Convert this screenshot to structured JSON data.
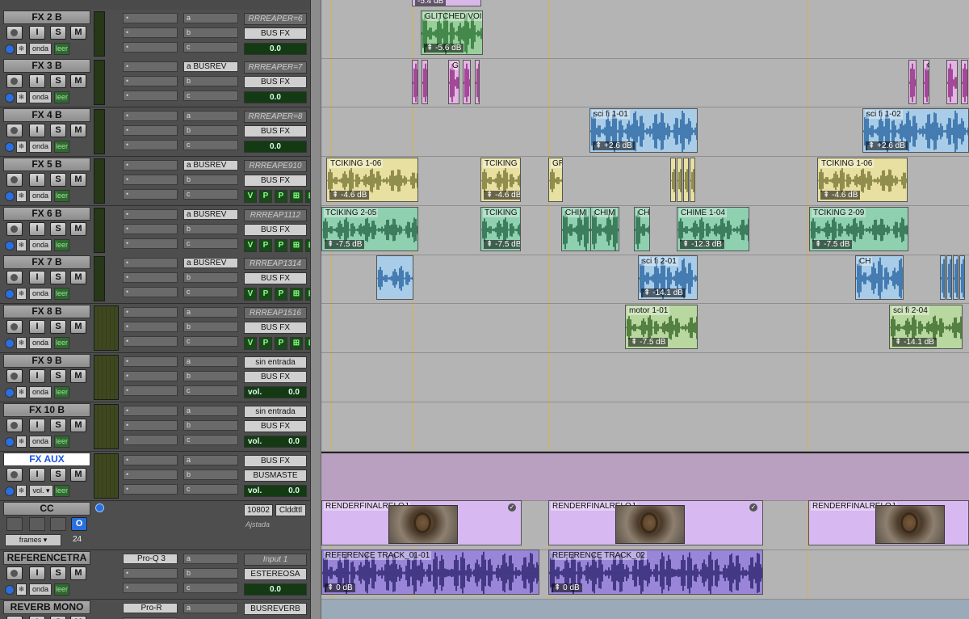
{
  "buttons": {
    "input": "I",
    "solo": "S",
    "mute": "M"
  },
  "tracks": [
    {
      "name": "FX 2 B",
      "ins": "",
      "sends": [
        "a",
        "b",
        "c"
      ],
      "io1": "RRREAPER=6",
      "io2": "BUS FX",
      "vol": "0.0",
      "mode": "onda",
      "leer": "leer",
      "dd": "▲",
      "sendbus": ""
    },
    {
      "name": "FX 3 B",
      "ins": "",
      "sends": [
        "a",
        "b",
        "c"
      ],
      "io1": "RRREAPER=7",
      "io2": "BUS FX",
      "vol": "0.0",
      "mode": "onda",
      "leer": "leer",
      "dd": "▲",
      "sendbus": "BUSREV"
    },
    {
      "name": "FX 4 B",
      "ins": "",
      "sends": [
        "a",
        "b",
        "c"
      ],
      "io1": "RRREAPER=8",
      "io2": "BUS FX",
      "vol": "0.0",
      "mode": "onda",
      "leer": "leer",
      "dd": "▲",
      "sendbus": ""
    },
    {
      "name": "FX 5 B",
      "ins": "",
      "sends": [
        "a",
        "b",
        "c"
      ],
      "io1": "RRREAPE910",
      "io2": "BUS FX",
      "vol": "",
      "mode": "onda",
      "leer": "leer",
      "dd": "▲",
      "sendbus": "BUSREV"
    },
    {
      "name": "FX 6 B",
      "ins": "",
      "sends": [
        "a",
        "b",
        "c"
      ],
      "io1": "RRREAP1112",
      "io2": "BUS FX",
      "vol": "",
      "mode": "onda",
      "leer": "leer",
      "dd": "▲",
      "sendbus": "BUSREV"
    },
    {
      "name": "FX 7 B",
      "ins": "",
      "sends": [
        "a",
        "b",
        "c"
      ],
      "io1": "RRREAP1314",
      "io2": "BUS FX",
      "vol": "",
      "mode": "onda",
      "leer": "leer",
      "dd": "▲",
      "sendbus": "BUSREV"
    },
    {
      "name": "FX 8 B",
      "ins": "",
      "sends": [
        "a",
        "b",
        "c"
      ],
      "io1": "RRREAP1516",
      "io2": "BUS FX",
      "vol": "",
      "mode": "onda",
      "leer": "leer",
      "dd": "▲",
      "sendbus": ""
    },
    {
      "name": "FX 9 B",
      "ins": "",
      "sends": [
        "a",
        "b",
        "c"
      ],
      "io1": "sin entrada",
      "io2": "BUS FX",
      "vol": "0.0",
      "vollabel": "vol.",
      "mode": "onda",
      "leer": "leer",
      "dd": "▲",
      "sendbus": ""
    },
    {
      "name": "FX 10 B",
      "ins": "",
      "sends": [
        "a",
        "b",
        "c"
      ],
      "io1": "sin entrada",
      "io2": "BUS FX",
      "vol": "0.0",
      "vollabel": "vol.",
      "mode": "onda",
      "leer": "leer",
      "dd": "▲",
      "sendbus": ""
    },
    {
      "name": "FX AUX",
      "ins": "",
      "sends": [
        "a",
        "b",
        "c"
      ],
      "io1": "BUS FX",
      "io2": "BUSMASTE",
      "vol": "0.0",
      "vollabel": "vol.",
      "mode": "vol.",
      "leer": "leer",
      "dd": "▼",
      "sendbus": ""
    },
    {
      "name": "CC",
      "tc1": "10802",
      "tc2": "Clddttl",
      "tc3": "Ajstada",
      "frames": "frames",
      "fps": "24"
    },
    {
      "name": "REFERENCETRA",
      "ins": "Pro-Q 3",
      "sends": [
        "a",
        "b",
        "c"
      ],
      "io1": "Input 1",
      "io2": "ESTEREOSA",
      "vol": "0.0",
      "mode": "onda",
      "leer": "leer",
      "dd": "▲",
      "sendbus": ""
    },
    {
      "name": "REVERB MONO",
      "ins": "Pro-R",
      "sends": [
        "a"
      ],
      "io1": "BUSREVERB",
      "io2": "",
      "vol": "",
      "mode": "",
      "leer": "",
      "dd": "",
      "sendbus": ""
    }
  ],
  "vpp": {
    "v": "V",
    "p": "P"
  },
  "clips": {
    "fx2": {
      "label": "GLITCHED VOI",
      "db": "-5.6 dB",
      "color": "#4f9a55"
    },
    "fx3": {
      "labels": [
        "Gl",
        "Gl"
      ],
      "color": "#d9a6d9"
    },
    "fx4": [
      {
        "label": "sci fi 1-01",
        "db": "+2.6 dB"
      },
      {
        "label": "sci fi 1-02",
        "db": "+2.6 dB"
      }
    ],
    "fx5": [
      {
        "label": "TCIKING 1-06",
        "db": "-4.6 dB"
      },
      {
        "label": "TCIKING",
        "db": "-4.6 dB"
      },
      {
        "label": "GR",
        "db": ""
      },
      {
        "label": "TCIKING 1-06",
        "db": "-4.6 dB"
      }
    ],
    "fx6": [
      {
        "label": "TCIKING 2-05",
        "db": "-7.5 dB"
      },
      {
        "label": "TCIKING",
        "db": "-7.5 dB"
      },
      {
        "label": "CHIM",
        "db": ""
      },
      {
        "label": "CHIM",
        "db": ""
      },
      {
        "label": "CH",
        "db": ""
      },
      {
        "label": "CHIME 1-04",
        "db": "-12.3 dB"
      },
      {
        "label": "TCIKING 2-09",
        "db": "-7.5 dB"
      }
    ],
    "fx7": [
      {
        "label": "sci fi 2-01",
        "db": "-14.1 dB"
      },
      {
        "label": "CH",
        "db": ""
      }
    ],
    "fx8": [
      {
        "label": "motor 1-01",
        "db": "-7.5 dB"
      },
      {
        "label": "sci fi 2-04",
        "db": "-14.1 dB"
      }
    ],
    "video": [
      "RENDERFINALRELOJ",
      "RENDERFINALRELOJ",
      "RENDERFINALRELOJ"
    ],
    "ref": [
      {
        "label": "REFERENCE TRACK_01-01",
        "db": "0 dB"
      },
      {
        "label": "REFERENCE TRACK_02",
        "db": "0 dB"
      }
    ]
  },
  "colors": {
    "green": "#8fd0b0",
    "yellow": "#e8e0a0",
    "blue": "#a8cde0",
    "lime": "#b8d8a0",
    "violet": "#d8b8f0",
    "ref": "#9a86d8",
    "aux": "#b9a0c0"
  }
}
